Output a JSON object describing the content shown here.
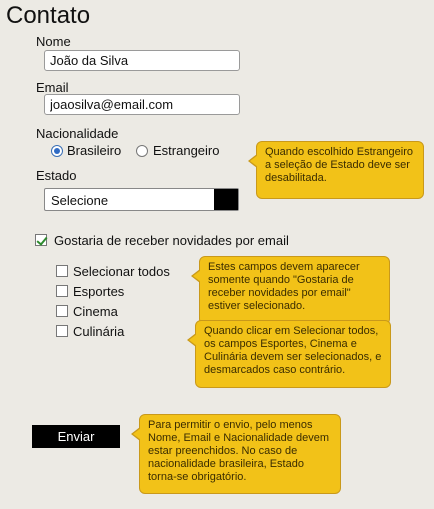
{
  "form": {
    "title": "Contato",
    "name_label": "Nome",
    "name_value": "João da Silva",
    "email_label": "Email",
    "email_value": "joaosilva@email.com",
    "nationality_label": "Nacionalidade",
    "nationality_options": [
      {
        "label": "Brasileiro",
        "selected": true
      },
      {
        "label": "Estrangeiro",
        "selected": false
      }
    ],
    "state_label": "Estado",
    "state_value": "Selecione",
    "newsletter_label": "Gostaria de receber novidades por email",
    "newsletter_checked": true,
    "topics": [
      {
        "label": "Selecionar todos",
        "checked": false
      },
      {
        "label": "Esportes",
        "checked": false
      },
      {
        "label": "Cinema",
        "checked": false
      },
      {
        "label": "Culinária",
        "checked": false
      }
    ],
    "submit_label": "Enviar"
  },
  "tooltips": {
    "state": "Quando escolhido Estrangeiro a seleção de Estado deve ser desabilitada.",
    "newsletter": "Estes campos devem aparecer somente quando \"Gostaria de receber novidades por email\" estiver selecionado.",
    "select_all": "Quando clicar em Selecionar todos, os campos Esportes, Cinema e Culinária devem ser selecionados, e desmarcados caso contrário.",
    "submit": "Para permitir o envio, pelo menos Nome, Email e Nacionalidade devem estar preenchidos. No caso de nacionalidade brasileira, Estado torna-se obrigatório."
  },
  "colors": {
    "background": "#eceae4",
    "tooltip": "#f2c218",
    "button": "#000000",
    "checkmark": "#2e8b2e",
    "radio_selected": "#2f6bc4"
  }
}
